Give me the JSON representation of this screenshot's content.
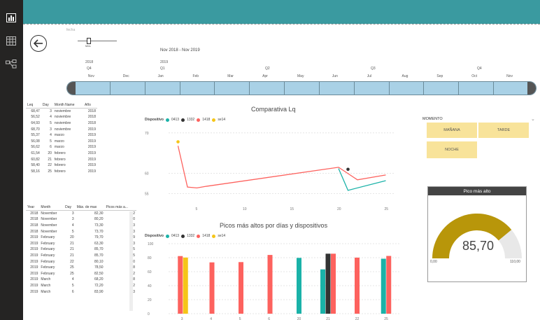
{
  "nav": {
    "icons": [
      "report-icon",
      "table-icon",
      "model-icon"
    ]
  },
  "date_slicer": {
    "field_label": "fecha",
    "level_labels": [
      "Mes"
    ],
    "range_label": "Nov 2018 - Nov 2019",
    "years": [
      {
        "label": "2018"
      },
      {
        "label": "2019"
      }
    ],
    "quarters": [
      "Q4",
      "Q1",
      "Q2",
      "Q3",
      "Q4"
    ],
    "months": [
      "Nov",
      "Dec",
      "Jan",
      "Feb",
      "Mar",
      "Apr",
      "May",
      "Jun",
      "Jul",
      "Aug",
      "Sep",
      "Oct",
      "Nov"
    ]
  },
  "table1": {
    "headers": [
      "Leq",
      "Day",
      "Month Name",
      "Año"
    ],
    "rows": [
      [
        "68,47",
        "3",
        "noviembre",
        "2018"
      ],
      [
        "56,52",
        "4",
        "noviembre",
        "2018"
      ],
      [
        "64,93",
        "5",
        "noviembre",
        "2018"
      ],
      [
        "68,70",
        "3",
        "noviembre",
        "2019"
      ],
      [
        "55,37",
        "4",
        "marzo",
        "2019"
      ],
      [
        "56,08",
        "5",
        "marzo",
        "2019"
      ],
      [
        "56,62",
        "6",
        "marzo",
        "2019"
      ],
      [
        "61,54",
        "20",
        "febrero",
        "2019"
      ],
      [
        "60,82",
        "21",
        "febrero",
        "2019"
      ],
      [
        "58,40",
        "22",
        "febrero",
        "2019"
      ],
      [
        "58,16",
        "25",
        "febrero",
        "2019"
      ]
    ]
  },
  "table2": {
    "headers": [
      "Year",
      "Month",
      "Day",
      "Máx. de max",
      "Picos más a..."
    ],
    "rows": [
      [
        "2018",
        "November",
        "3",
        "82,30",
        "82"
      ],
      [
        "2018",
        "November",
        "3",
        "80,20",
        "80"
      ],
      [
        "2018",
        "November",
        "4",
        "73,30",
        "73"
      ],
      [
        "2018",
        "November",
        "5",
        "73,70",
        "73"
      ],
      [
        "2019",
        "February",
        "20",
        "79,70",
        "79"
      ],
      [
        "2019",
        "February",
        "21",
        "63,30",
        "63"
      ],
      [
        "2019",
        "February",
        "21",
        "85,70",
        "85"
      ],
      [
        "2019",
        "February",
        "21",
        "85,70",
        "85"
      ],
      [
        "2019",
        "February",
        "22",
        "80,10",
        "80"
      ],
      [
        "2019",
        "February",
        "25",
        "78,50",
        "78"
      ],
      [
        "2019",
        "February",
        "25",
        "82,50",
        "82"
      ],
      [
        "2019",
        "March",
        "4",
        "68,20",
        "68"
      ],
      [
        "2019",
        "March",
        "5",
        "72,20",
        "72"
      ],
      [
        "2019",
        "March",
        "6",
        "83,90",
        "83"
      ]
    ]
  },
  "line_chart": {
    "title": "Comparativa Lq",
    "legend_title": "Dispositivo",
    "legend": [
      {
        "name": "0413",
        "color": "#1ab2a8"
      },
      {
        "name": "1332",
        "color": "#333333"
      },
      {
        "name": "1418",
        "color": "#fd625e"
      },
      {
        "name": "se14",
        "color": "#f5c518"
      }
    ],
    "x_ticks": [
      "5",
      "10",
      "15",
      "20",
      "25"
    ],
    "y_ticks": [
      "70",
      "60",
      "55"
    ]
  },
  "chart_data": [
    {
      "type": "line",
      "title": "Comparativa Lq",
      "xlim": [
        2,
        26
      ],
      "ylim": [
        53,
        71
      ],
      "x_ticks": [
        5,
        10,
        15,
        20,
        25
      ],
      "y_ticks": [
        55,
        60,
        70
      ],
      "series": [
        {
          "name": "0413",
          "color": "#1ab2a8",
          "points": [
            [
              20,
              61.2
            ],
            [
              21,
              55.8
            ],
            [
              25,
              58.2
            ]
          ]
        },
        {
          "name": "1332",
          "color": "#333333",
          "points": [
            [
              21,
              61.0
            ]
          ]
        },
        {
          "name": "1418",
          "color": "#fd625e",
          "points": [
            [
              3,
              66.8
            ],
            [
              4,
              56.6
            ],
            [
              5,
              56.4
            ],
            [
              6,
              56.8
            ],
            [
              20,
              61.5
            ],
            [
              22,
              58.4
            ],
            [
              25,
              59.6
            ]
          ]
        },
        {
          "name": "se14",
          "color": "#f5c518",
          "points": [
            [
              3,
              67.8
            ]
          ]
        }
      ]
    },
    {
      "type": "bar",
      "title": "Picos más altos por días y dispositivos",
      "categories": [
        "3",
        "4",
        "5",
        "6",
        "20",
        "21",
        "22",
        "25"
      ],
      "ylim": [
        0,
        100
      ],
      "y_ticks": [
        0,
        20,
        40,
        60,
        80,
        100
      ],
      "bars": [
        {
          "cat": "3",
          "series": "1418",
          "color": "#fd625e",
          "value": 82.3
        },
        {
          "cat": "3",
          "series": "se14",
          "color": "#f5c518",
          "value": 80.2
        },
        {
          "cat": "4",
          "series": "1418",
          "color": "#fd625e",
          "value": 73.3
        },
        {
          "cat": "5",
          "series": "1418",
          "color": "#fd625e",
          "value": 73.7
        },
        {
          "cat": "6",
          "series": "1418",
          "color": "#fd625e",
          "value": 83.9
        },
        {
          "cat": "20",
          "series": "0413",
          "color": "#1ab2a8",
          "value": 79.7
        },
        {
          "cat": "21",
          "series": "0413",
          "color": "#1ab2a8",
          "value": 63.3
        },
        {
          "cat": "21",
          "series": "1332",
          "color": "#333333",
          "value": 85.7
        },
        {
          "cat": "21",
          "series": "1418",
          "color": "#fd625e",
          "value": 85.7
        },
        {
          "cat": "22",
          "series": "1418",
          "color": "#fd625e",
          "value": 80.1
        },
        {
          "cat": "25",
          "series": "0413",
          "color": "#1ab2a8",
          "value": 78.5
        },
        {
          "cat": "25",
          "series": "1418",
          "color": "#fd625e",
          "value": 82.5
        }
      ]
    }
  ],
  "bar_chart": {
    "title": "Picos más altos por días y dispositivos",
    "legend_title": "Dispositivo",
    "legend": [
      {
        "name": "0413",
        "color": "#1ab2a8"
      },
      {
        "name": "1332",
        "color": "#333333"
      },
      {
        "name": "1418",
        "color": "#fd625e"
      },
      {
        "name": "se14",
        "color": "#f5c518"
      }
    ],
    "x_ticks": [
      "3",
      "4",
      "5",
      "6",
      "20",
      "21",
      "22",
      "25"
    ],
    "y_ticks": [
      "100",
      "80",
      "60",
      "40",
      "20",
      "0"
    ]
  },
  "momento": {
    "title": "MOMENTO",
    "options": [
      "MAÑANA",
      "TARDE",
      "NOCHE"
    ]
  },
  "gauge": {
    "title": "Pico más alto",
    "value_label": "85,70",
    "min_label": "0,00",
    "max_label": "110,00",
    "value": 85.7,
    "min": 0,
    "max": 110,
    "fill_color": "#b8960a"
  }
}
